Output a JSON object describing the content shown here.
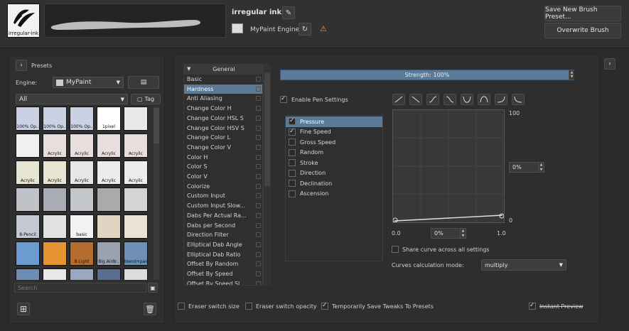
{
  "header": {
    "brush_thumb_label": "irregular-ink",
    "brush_name": "irregular ink",
    "engine": "MyPaint Engine",
    "save_new_label": "Save New Brush Preset...",
    "overwrite_label": "Overwrite Brush"
  },
  "presets": {
    "title": "Presets",
    "engine_label": "Engine:",
    "engine_value": "MyPaint",
    "filter_value": "All",
    "tag_label": "Tag",
    "search_placeholder": "Search",
    "tiles": [
      {
        "label": "100% Op..",
        "color": "#c9d1e3"
      },
      {
        "label": "100% Op..",
        "color": "#c9d1e3"
      },
      {
        "label": "100% Op..",
        "color": "#c9d1e3"
      },
      {
        "label": "1pixel",
        "color": "#ffffff"
      },
      {
        "label": "",
        "color": "#e9e9e9"
      },
      {
        "label": "",
        "color": "#f0f0f0"
      },
      {
        "label": "Acrylic",
        "color": "#e8dede"
      },
      {
        "label": "Acrylic",
        "color": "#e8dede"
      },
      {
        "label": "Acrylic",
        "color": "#e8dede"
      },
      {
        "label": "Acrylic",
        "color": "#e8dede"
      },
      {
        "label": "Acrylic",
        "color": "#e6e6d2"
      },
      {
        "label": "Acrylic",
        "color": "#e6e6d2"
      },
      {
        "label": "Acrylic",
        "color": "#e6e6e6"
      },
      {
        "label": "Acrylic",
        "color": "#ececec"
      },
      {
        "label": "Acrylic",
        "color": "#ececec"
      },
      {
        "label": "",
        "color": "#bfc3c8"
      },
      {
        "label": "",
        "color": "#a9adb3"
      },
      {
        "label": "",
        "color": "#c3c7cc"
      },
      {
        "label": "",
        "color": "#aaaaaa"
      },
      {
        "label": "",
        "color": "#d4d4d4"
      },
      {
        "label": "8-Pencil",
        "color": "#c4c8d0"
      },
      {
        "label": "",
        "color": "#e2e2e2"
      },
      {
        "label": "basic",
        "color": "#f2f2f2"
      },
      {
        "label": "",
        "color": "#e3d3c2"
      },
      {
        "label": "",
        "color": "#ebe4d6"
      },
      {
        "label": "",
        "color": "#6b9bd1"
      },
      {
        "label": "",
        "color": "#e69432"
      },
      {
        "label": "B.Light",
        "color": "#b56d2f"
      },
      {
        "label": "Big AirBr..",
        "color": "#9aa3ad"
      },
      {
        "label": "blend+paint",
        "color": "#6e8fb6"
      },
      {
        "label": "",
        "color": "#6d8db5"
      },
      {
        "label": "",
        "color": "#e8e8e8"
      },
      {
        "label": "",
        "color": "#9aa9bf"
      },
      {
        "label": "",
        "color": "#5a6f8f"
      },
      {
        "label": "",
        "color": "#dcdcdc"
      }
    ],
    "tile_colors_note": "tile swatch colors as shown"
  },
  "settings_list": {
    "header": "General",
    "items": [
      "Basic",
      "Hardness",
      "Anti Aliasing",
      "Change Color H",
      "Change Color HSL S",
      "Change Color HSV S",
      "Change Color L",
      "Change Color V",
      "Color H",
      "Color S",
      "Color V",
      "Colorize",
      "Custom Input",
      "Custom Input Slow...",
      "Dabs Per Actual Ra...",
      "Dabs per Second",
      "Direction Filter",
      "Elliptical Dab Angle",
      "Elliptical Dab Ratio",
      "Offset By Random",
      "Offset By Speed",
      "Offset By Speed Sl..."
    ],
    "selected_index": 1
  },
  "strength": {
    "label": "Strength: 100%",
    "value": 1.0
  },
  "enable_pen": {
    "label": "Enable Pen Settings",
    "checked": true
  },
  "sensors": [
    {
      "label": "Pressure",
      "checked": true,
      "selected": true
    },
    {
      "label": "Fine Speed",
      "checked": true,
      "selected": false
    },
    {
      "label": "Gross Speed",
      "checked": false,
      "selected": false
    },
    {
      "label": "Random",
      "checked": false,
      "selected": false
    },
    {
      "label": "Stroke",
      "checked": false,
      "selected": false
    },
    {
      "label": "Direction",
      "checked": false,
      "selected": false
    },
    {
      "label": "Declination",
      "checked": false,
      "selected": false
    },
    {
      "label": "Ascension",
      "checked": false,
      "selected": false
    }
  ],
  "curve": {
    "y_max_label": "100",
    "y_min_label": "0",
    "x_min_label": "0.0",
    "x_max_label": "1.0",
    "y_value": "0%",
    "x_value": "0%",
    "share_label": "Share curve across all settings",
    "calc_mode_label": "Curves calculation mode:",
    "calc_mode_value": "multiply"
  },
  "footer": {
    "eraser_size": "Eraser switch size",
    "eraser_opacity": "Eraser switch opacity",
    "temp_save": "Temporarily Save Tweaks To Presets",
    "instant_preview": "Instant Preview"
  },
  "colors": {
    "selection": "#5a7a98",
    "background": "#2b2b2b"
  }
}
